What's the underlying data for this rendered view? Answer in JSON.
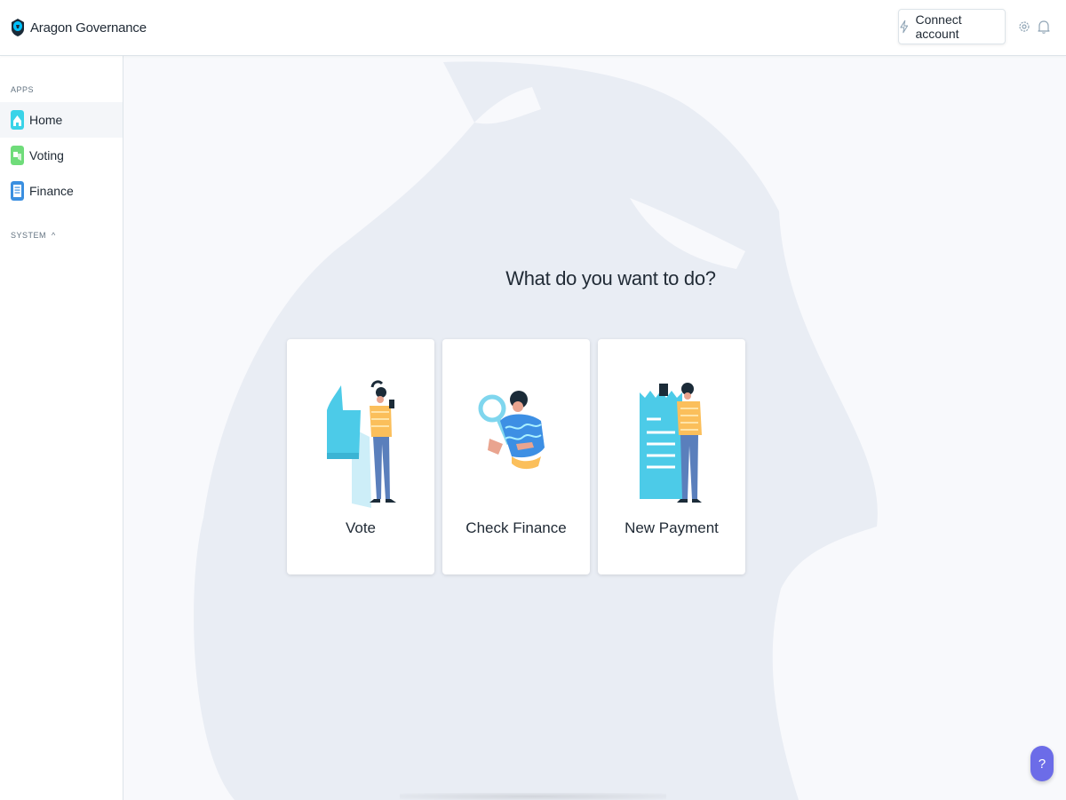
{
  "header": {
    "app_name": "Aragon Governance",
    "connect_label": "Connect account",
    "icons": [
      "aragon-logo-icon",
      "bolt-icon",
      "gear-icon",
      "bell-icon"
    ]
  },
  "sidebar": {
    "apps_label": "APPS",
    "items": [
      {
        "label": "Home",
        "icon": "home-app-icon",
        "active": true
      },
      {
        "label": "Voting",
        "icon": "voting-app-icon",
        "active": false
      },
      {
        "label": "Finance",
        "icon": "finance-app-icon",
        "active": false
      }
    ],
    "system_label": "SYSTEM",
    "system_caret": "^"
  },
  "main": {
    "headline": "What do you want to do?",
    "cards": [
      {
        "label": "Vote",
        "illustration": "thumbs-up-illustration"
      },
      {
        "label": "Check Finance",
        "illustration": "magnifier-illustration"
      },
      {
        "label": "New Payment",
        "illustration": "receipt-illustration"
      }
    ]
  },
  "help": {
    "label": "?"
  },
  "colors": {
    "accent": "#6c6ce8",
    "teal": "#00c2ff",
    "watermark": "#e9edf4",
    "background": "#f8f9fc"
  }
}
